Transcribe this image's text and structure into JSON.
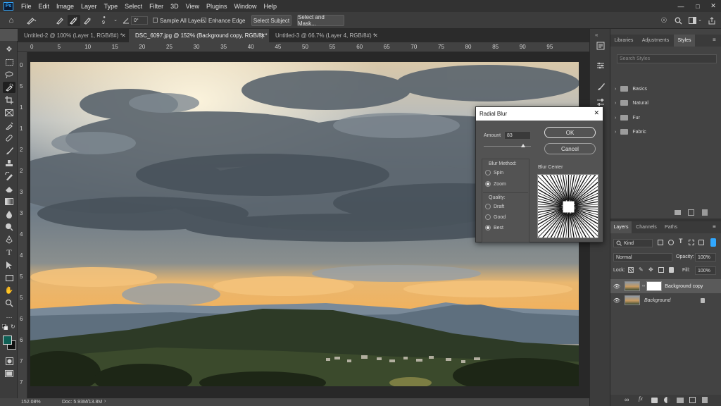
{
  "app": {
    "logo": "Ps",
    "menu": [
      "File",
      "Edit",
      "Image",
      "Layer",
      "Type",
      "Select",
      "Filter",
      "3D",
      "View",
      "Plugins",
      "Window",
      "Help"
    ],
    "window_controls": [
      "minimize-icon",
      "maximize-icon",
      "close-icon"
    ]
  },
  "options_bar": {
    "brush_size": "9",
    "angle_value": "0°",
    "sample_all_layers": "Sample All Layers",
    "enhance_edge": "Enhance Edge",
    "select_subject": "Select Subject",
    "select_and_mask": "Select and Mask..."
  },
  "tabs": [
    {
      "label": "Untitled-2 @ 100% (Layer 1, RGB/8#) *",
      "active": false
    },
    {
      "label": "DSC_6097.jpg @ 152% (Background copy, RGB/8) *",
      "active": true
    },
    {
      "label": "Untitled-3 @ 66.7% (Layer 4, RGB/8#) *",
      "active": false
    }
  ],
  "ruler_top": [
    "0",
    "5",
    "10",
    "15",
    "20",
    "25",
    "30",
    "35",
    "40",
    "45",
    "50",
    "55",
    "60",
    "65",
    "70",
    "75",
    "80",
    "85",
    "90",
    "95"
  ],
  "ruler_left": [
    "0",
    "5",
    "1",
    "1",
    "2",
    "2",
    "3",
    "3",
    "4",
    "4",
    "5",
    "5",
    "6",
    "6",
    "7",
    "7"
  ],
  "status": {
    "zoom": "152.08%",
    "doc": "Doc: 5.93M/13.8M"
  },
  "colors": {
    "foreground": "#0f5f55",
    "background": "#111111",
    "accent": "#31a8ff",
    "dialog_title": "#ffffff"
  },
  "dialog": {
    "title": "Radial Blur",
    "amount_label": "Amount",
    "amount_value": "83",
    "amount_fraction": 0.83,
    "ok": "OK",
    "cancel": "Cancel",
    "blur_method_label": "Blur Method:",
    "methods": [
      "Spin",
      "Zoom"
    ],
    "method_selected": "Zoom",
    "quality_label": "Quality:",
    "qualities": [
      "Draft",
      "Good",
      "Best"
    ],
    "quality_selected": "Best",
    "blur_center_label": "Blur Center"
  },
  "styles_panel": {
    "tabs": [
      "Libraries",
      "Adjustments",
      "Styles"
    ],
    "active_tab": "Styles",
    "search_placeholder": "Search Styles",
    "groups": [
      "Basics",
      "Natural",
      "Fur",
      "Fabric"
    ]
  },
  "layers_panel": {
    "tabs": [
      "Layers",
      "Channels",
      "Paths"
    ],
    "active_tab": "Layers",
    "kind_label": "Kind",
    "blend_mode": "Normal",
    "opacity_label": "Opacity:",
    "opacity_value": "100%",
    "lock_label": "Lock:",
    "fill_label": "Fill:",
    "fill_value": "100%",
    "layers": [
      {
        "name": "Background copy",
        "selected": true
      },
      {
        "name": "Background",
        "selected": false
      }
    ]
  }
}
